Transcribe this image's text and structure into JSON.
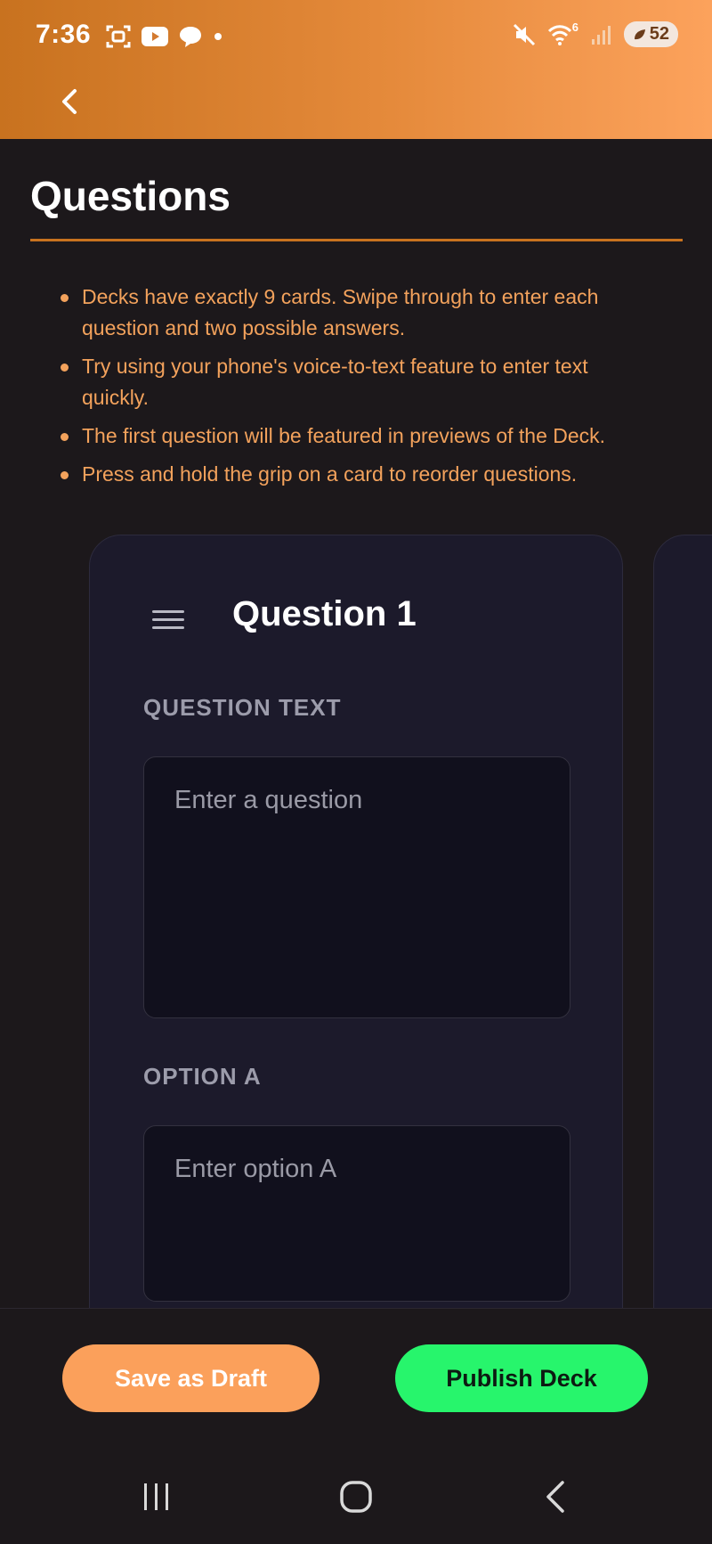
{
  "status_bar": {
    "time": "7:36",
    "network_label": "6",
    "battery": "52",
    "left_icons": [
      "screenshot-icon",
      "youtube-icon",
      "chat-bubble-icon",
      "dot-icon"
    ],
    "right_icons": [
      "mute-icon",
      "wifi-icon",
      "signal-icon"
    ]
  },
  "header": {
    "back_icon": "chevron-left-icon",
    "gradient_colors": [
      "#c8721f",
      "#fca25c"
    ]
  },
  "page": {
    "title": "Questions",
    "tips": [
      "Decks have exactly 9 cards. Swipe through to enter each question and two possible answers.",
      "Try using your phone's voice-to-text feature to enter text quickly.",
      "The first question will be featured in previews of the Deck.",
      "Press and hold the grip on a card to reorder questions."
    ]
  },
  "card": {
    "grip_icon": "grip-icon",
    "title": "Question 1",
    "question_label": "QUESTION TEXT",
    "question_placeholder": "Enter a question",
    "question_value": "",
    "option_a_label": "OPTION A",
    "option_a_placeholder": "Enter option A",
    "option_a_value": ""
  },
  "actions": {
    "save_draft_label": "Save as Draft",
    "publish_label": "Publish Deck",
    "save_draft_color": "#fba05b",
    "publish_color": "#27f56c"
  },
  "nav_bar": {
    "icons": [
      "recent-apps-icon",
      "home-icon",
      "back-icon"
    ]
  },
  "colors": {
    "accent": "#c8721f",
    "tip_text": "#f3a25c",
    "background": "#1c181b",
    "card_background": "#1c1a2b"
  }
}
